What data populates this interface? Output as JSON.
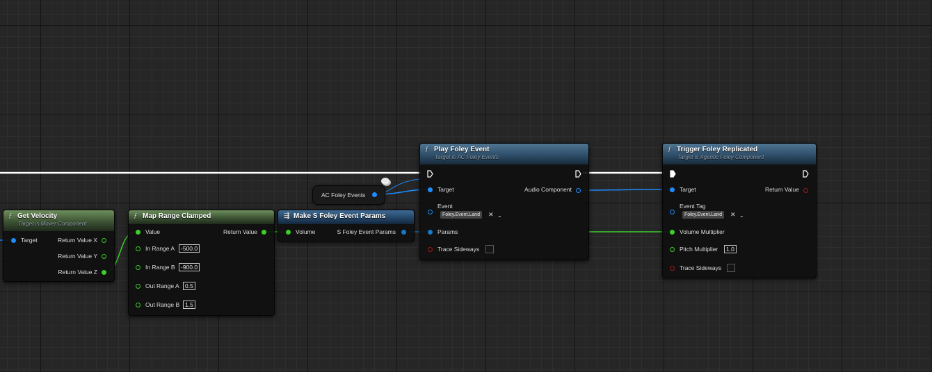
{
  "colors": {
    "background": "#262626",
    "exec_wire": "#ffffff",
    "object_pin": "#1c8cff",
    "float_pin": "#3ccf2a",
    "bool_pin": "#a01a1a",
    "struct_pin": "#1a78c8"
  },
  "get_velocity": {
    "title": "Get Velocity",
    "subtitle": "Target is Mover Component",
    "icon": "function-icon",
    "inputs": {
      "target": "Target"
    },
    "outputs": {
      "x": "Return Value X",
      "y": "Return Value Y",
      "z": "Return Value Z"
    }
  },
  "map_range": {
    "title": "Map Range Clamped",
    "icon": "function-icon",
    "value_label": "Value",
    "return_label": "Return Value",
    "in_a_label": "In Range A",
    "in_a_value": "-500.0",
    "in_b_label": "In Range B",
    "in_b_value": "-900.0",
    "out_a_label": "Out Range A",
    "out_a_value": "0.5",
    "out_b_label": "Out Range B",
    "out_b_value": "1.5"
  },
  "make_params": {
    "title": "Make S Foley Event Params",
    "icon": "make-struct-icon",
    "volume_label": "Volume",
    "output_label": "S Foley Event Params"
  },
  "ac_foley_events": {
    "label": "AC Foley Events"
  },
  "play_foley": {
    "title": "Play Foley Event",
    "subtitle": "Target is AC Foley Events",
    "icon": "function-icon",
    "target_label": "Target",
    "audio_component_label": "Audio Component",
    "event_label": "Event",
    "event_tag": "Foley.Event.Land",
    "params_label": "Params",
    "trace_label": "Trace Sideways"
  },
  "trigger_foley": {
    "title": "Trigger Foley Replicated",
    "subtitle": "Target is Agentic Foley Component",
    "icon": "function-icon",
    "target_label": "Target",
    "return_label": "Return Value",
    "event_tag_label": "Event Tag",
    "event_tag": "Foley.Event.Land",
    "volume_label": "Volume Multiplier",
    "pitch_label": "Pitch Multiplier",
    "pitch_value": "1.0",
    "trace_label": "Trace Sideways"
  }
}
